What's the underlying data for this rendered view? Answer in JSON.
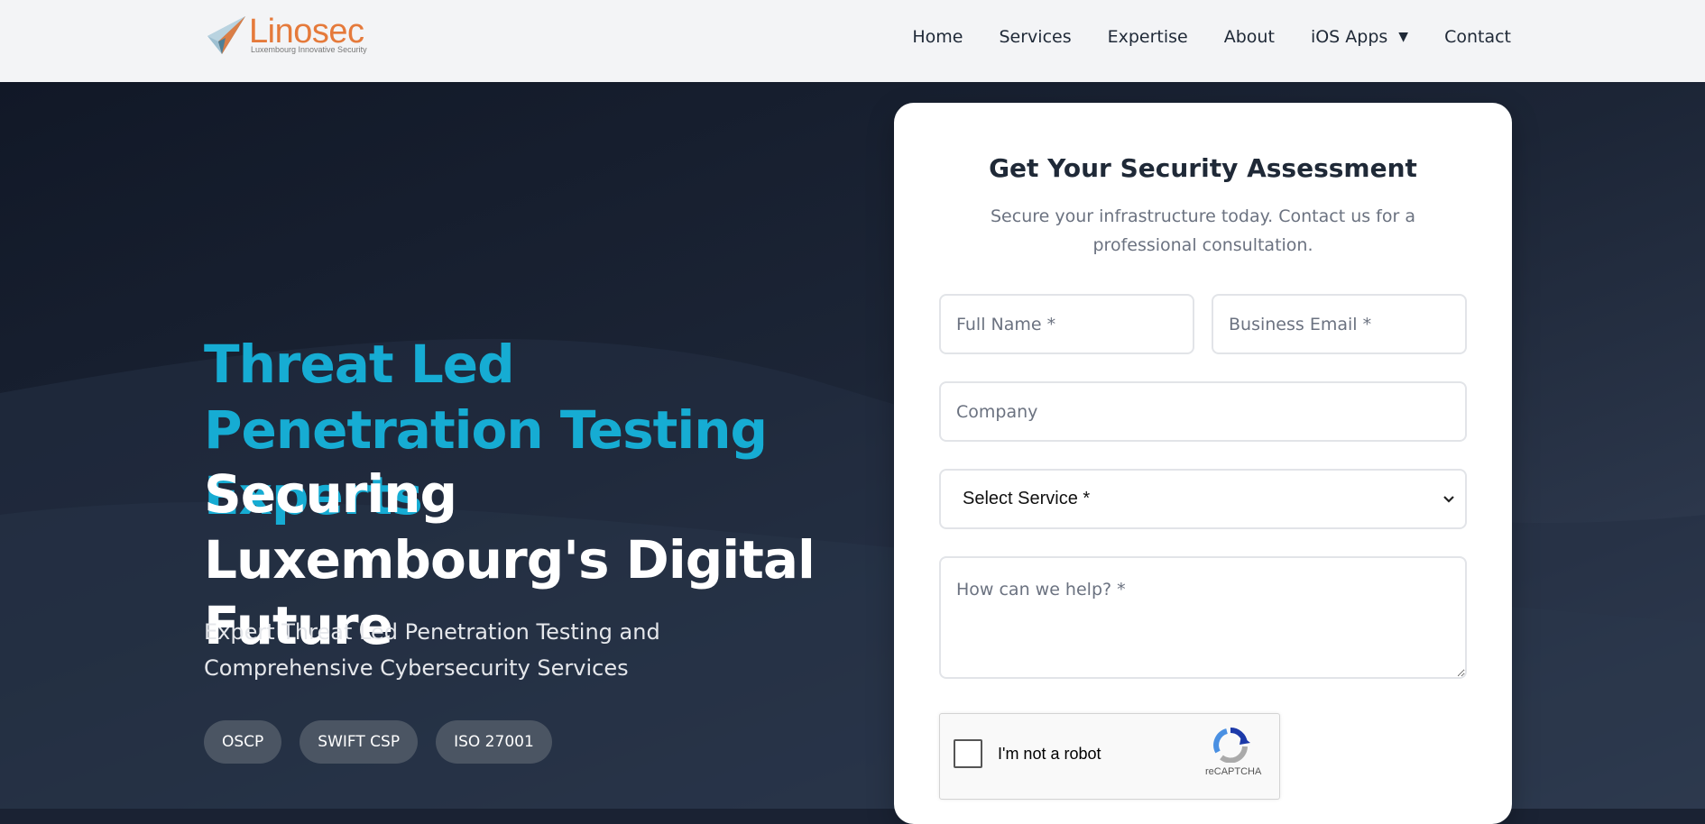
{
  "brand": {
    "name": "Linosec",
    "tagline": "Luxembourg Innovative Security",
    "color": "#e57a3b"
  },
  "nav": {
    "items": [
      "Home",
      "Services",
      "Expertise",
      "About",
      "iOS Apps",
      "Contact"
    ],
    "dropdown_caret": "▼"
  },
  "hero": {
    "headline_accent": "Threat Led Penetration Testing Experts",
    "headline_main": "Securing Luxembourg's Digital Future",
    "subheadline": "Expert Threat Led Penetration Testing and Comprehensive Cybersecurity Services",
    "badges": [
      "OSCP",
      "SWIFT CSP",
      "ISO 27001"
    ],
    "accent_color": "#16acd3"
  },
  "form": {
    "title": "Get Your Security Assessment",
    "subtitle": "Secure your infrastructure today. Contact us for a professional consultation.",
    "full_name_placeholder": "Full Name *",
    "email_placeholder": "Business Email *",
    "company_placeholder": "Company",
    "service_selected": "Select Service *",
    "message_placeholder": "How can we help? *",
    "recaptcha_label": "I'm not a robot",
    "recaptcha_brand": "reCAPTCHA"
  }
}
